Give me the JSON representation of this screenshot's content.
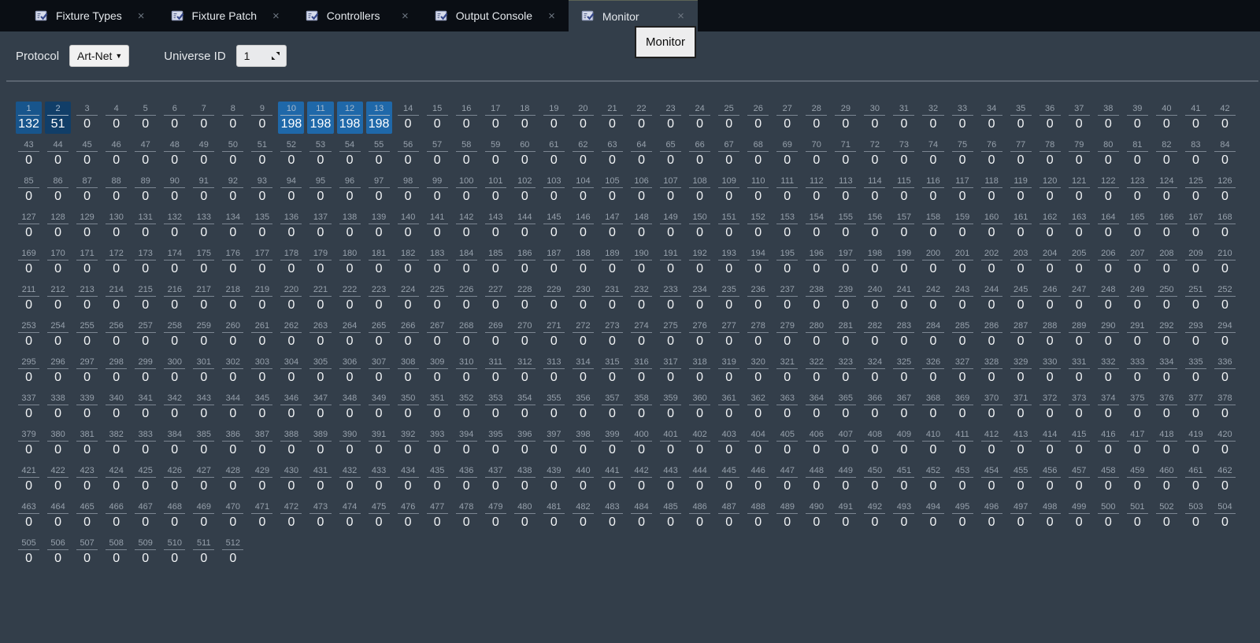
{
  "tabs": [
    {
      "label": "Fixture Types",
      "active": false
    },
    {
      "label": "Fixture Patch",
      "active": false
    },
    {
      "label": "Controllers",
      "active": false
    },
    {
      "label": "Output Console",
      "active": false
    },
    {
      "label": "Monitor",
      "active": true
    }
  ],
  "close_glyph": "×",
  "tooltip": {
    "text": "Monitor"
  },
  "toolbar": {
    "protocol_label": "Protocol",
    "protocol_value": "Art-Net",
    "universe_label": "Universe ID",
    "universe_value": "1"
  },
  "grid": {
    "channel_count": 512,
    "columns": 42,
    "default_value": 0,
    "overrides": {
      "1": 132,
      "2": 51,
      "10": 198,
      "11": 198,
      "12": 198,
      "13": 198
    }
  },
  "colors": {
    "highlight_low": "#0c2f52",
    "highlight_high": "#2478c2",
    "active_tab_bg": "#333e4a",
    "tabbar_bg": "#0a0e14"
  }
}
